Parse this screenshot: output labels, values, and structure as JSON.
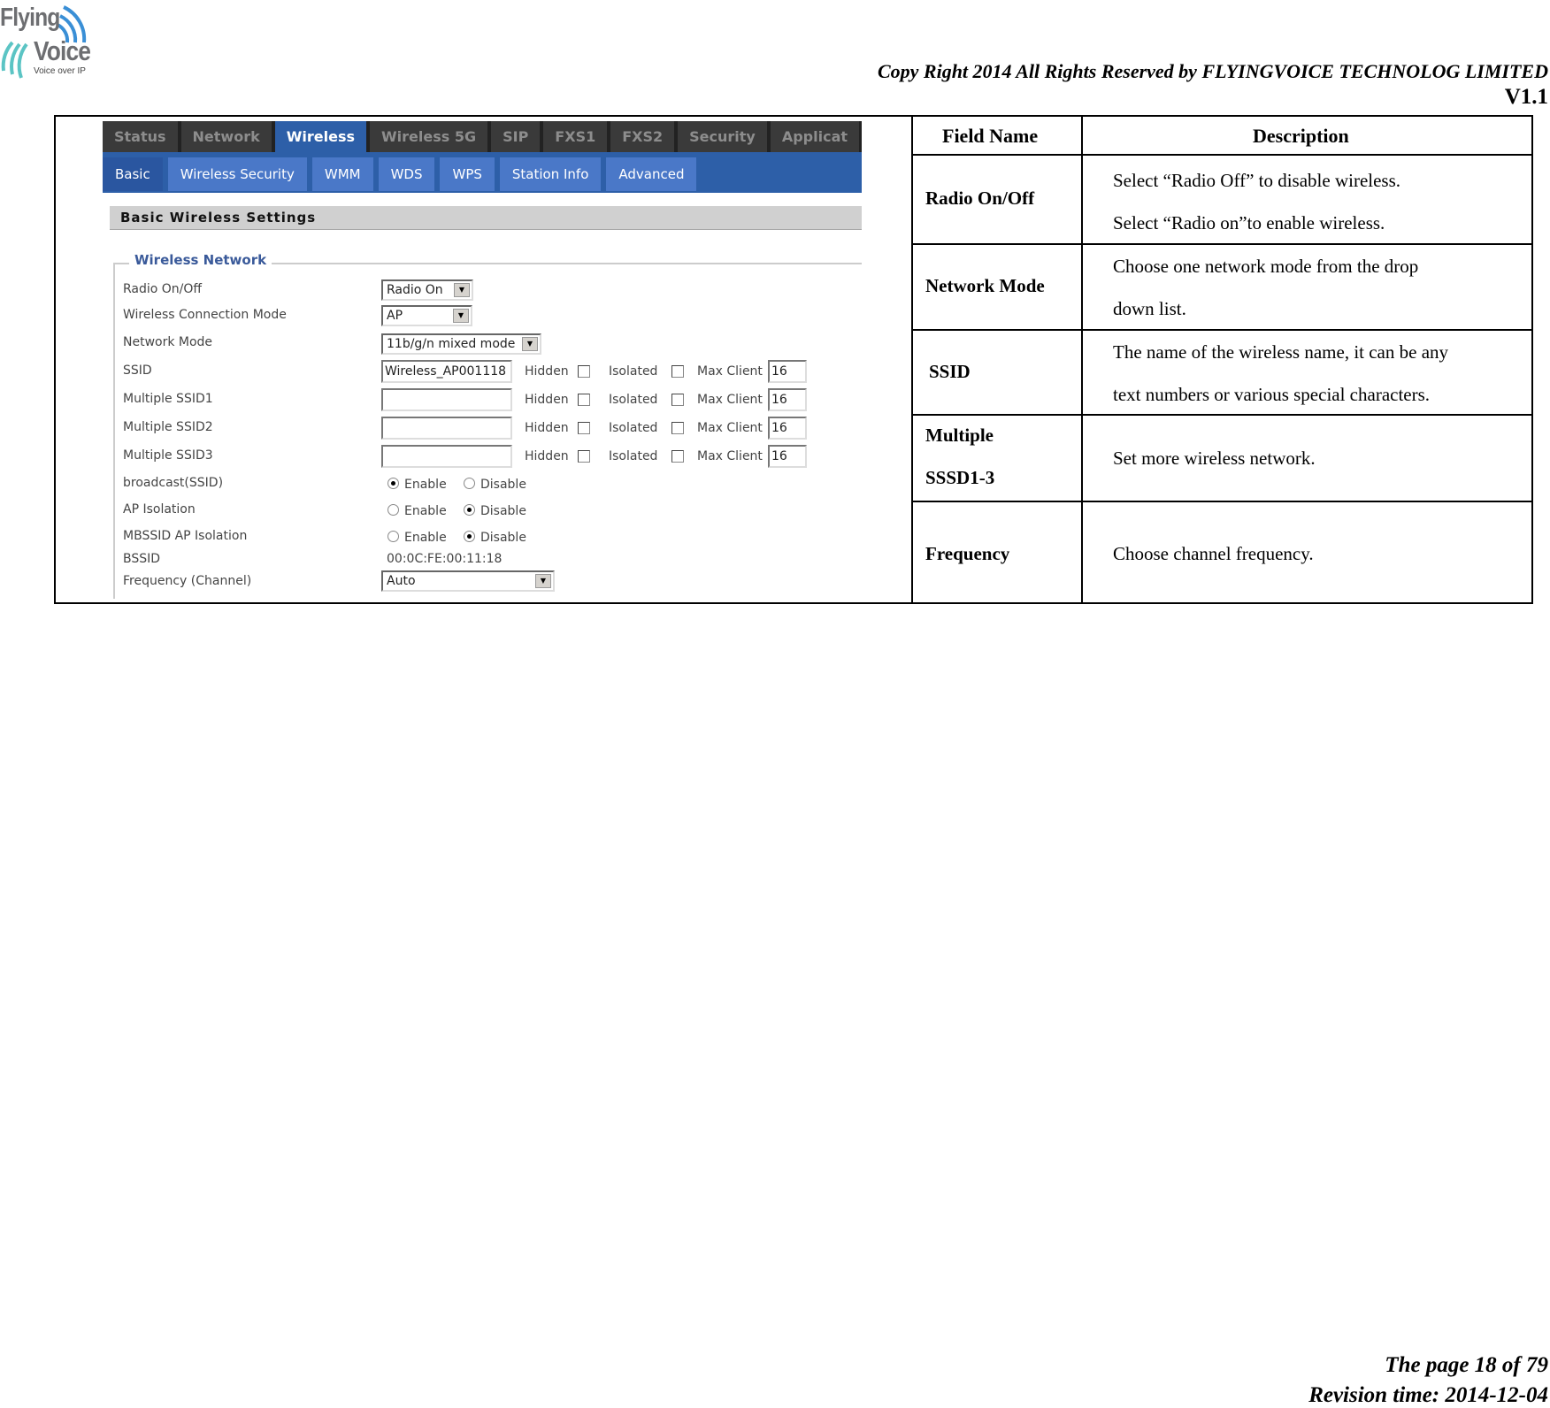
{
  "header": {
    "logo": {
      "line1": "Flying",
      "line2": "Voice",
      "tagline": "Voice over IP"
    },
    "copyright": "Copy Right 2014 All Rights Reserved by FLYINGVOICE TECHNOLOG LIMITED",
    "version": "V1.1"
  },
  "screenshot": {
    "top_tabs": [
      {
        "label": "Status",
        "active": false
      },
      {
        "label": "Network",
        "active": false
      },
      {
        "label": "Wireless",
        "active": true
      },
      {
        "label": "Wireless 5G",
        "active": false
      },
      {
        "label": "SIP",
        "active": false
      },
      {
        "label": "FXS1",
        "active": false
      },
      {
        "label": "FXS2",
        "active": false
      },
      {
        "label": "Security",
        "active": false
      },
      {
        "label": "Applicat",
        "active": false
      }
    ],
    "sub_tabs": [
      {
        "label": "Basic",
        "active": true
      },
      {
        "label": "Wireless Security",
        "active": false
      },
      {
        "label": "WMM",
        "active": false
      },
      {
        "label": "WDS",
        "active": false
      },
      {
        "label": "WPS",
        "active": false
      },
      {
        "label": "Station Info",
        "active": false
      },
      {
        "label": "Advanced",
        "active": false
      }
    ],
    "section_title": "Basic Wireless Settings",
    "fieldset_legend": "Wireless Network",
    "fields": {
      "radio_label": "Radio On/Off",
      "radio_value": "Radio On",
      "conn_mode_label": "Wireless Connection Mode",
      "conn_mode_value": "AP",
      "net_mode_label": "Network Mode",
      "net_mode_value": "11b/g/n mixed mode",
      "ssid_rows": [
        {
          "label": "SSID",
          "value": "Wireless_AP001118",
          "hidden": false,
          "isolated": false,
          "max_client": "16"
        },
        {
          "label": "Multiple SSID1",
          "value": "",
          "hidden": false,
          "isolated": false,
          "max_client": "16"
        },
        {
          "label": "Multiple SSID2",
          "value": "",
          "hidden": false,
          "isolated": false,
          "max_client": "16"
        },
        {
          "label": "Multiple SSID3",
          "value": "",
          "hidden": false,
          "isolated": false,
          "max_client": "16"
        }
      ],
      "hidden_label": "Hidden",
      "isolated_label": "Isolated",
      "max_client_label": "Max Client",
      "radios": [
        {
          "label": "broadcast(SSID)",
          "selected": "Enable"
        },
        {
          "label": "AP Isolation",
          "selected": "Disable"
        },
        {
          "label": "MBSSID AP Isolation",
          "selected": "Disable"
        }
      ],
      "enable_label": "Enable",
      "disable_label": "Disable",
      "bssid_label": "BSSID",
      "bssid_value": "00:0C:FE:00:11:18",
      "freq_label": "Frequency (Channel)",
      "freq_value": "Auto"
    }
  },
  "table": {
    "headers": [
      "Field Name",
      "Description"
    ],
    "rows": [
      {
        "field": "Radio On/Off",
        "desc": [
          "Select “Radio Off” to disable wireless.",
          "Select “Radio on”to enable wireless."
        ]
      },
      {
        "field": "Network Mode",
        "desc": [
          "Choose one network mode from the drop",
          "down list."
        ]
      },
      {
        "field": "SSID",
        "desc": [
          "The name of the wireless name, it can be any",
          "text numbers or various special characters."
        ]
      },
      {
        "field": "Multiple SSSD1-3",
        "field_lines": [
          "Multiple",
          "SSSD1-3"
        ],
        "desc": [
          "Set more wireless network."
        ]
      },
      {
        "field": "Frequency",
        "desc": [
          "Choose channel frequency."
        ]
      }
    ]
  },
  "footer": {
    "page": "The page 18 of 79",
    "revision": "Revision time: 2014-12-04"
  }
}
